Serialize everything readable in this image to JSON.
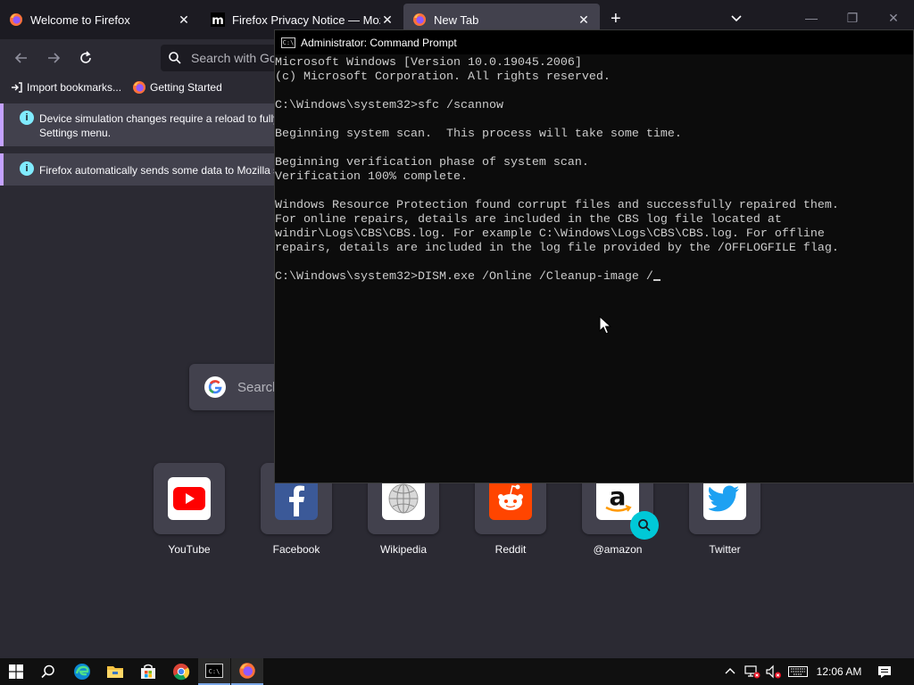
{
  "firefox": {
    "tabs": [
      {
        "label": "Welcome to Firefox",
        "active": false
      },
      {
        "label": "Firefox Privacy Notice — Mozilla",
        "active": false
      },
      {
        "label": "New Tab",
        "active": true
      }
    ],
    "urlbar_placeholder": "Search with Google or enter address",
    "bookmarks": [
      {
        "label": "Import bookmarks..."
      },
      {
        "label": "Getting Started"
      }
    ],
    "notices": [
      {
        "lines": [
          "Device simulation changes require a reload to fully apply. Automatic reloads are disabled by default to avoid losing any changes. You can enable the reload via the",
          "Settings menu."
        ]
      },
      {
        "lines": [
          "Firefox automatically sends some data to Mozilla so that we can improve your experience."
        ]
      }
    ],
    "web_search_placeholder": "Search the web",
    "top_sites": [
      {
        "name": "YouTube"
      },
      {
        "name": "Facebook"
      },
      {
        "name": "Wikipedia"
      },
      {
        "name": "Reddit"
      },
      {
        "name": "@amazon"
      },
      {
        "name": "Twitter"
      }
    ]
  },
  "cmd": {
    "title": "Administrator: Command Prompt",
    "lines": [
      "Microsoft Windows [Version 10.0.19045.2006]",
      "(c) Microsoft Corporation. All rights reserved.",
      "",
      "C:\\Windows\\system32>sfc /scannow",
      "",
      "Beginning system scan.  This process will take some time.",
      "",
      "Beginning verification phase of system scan.",
      "Verification 100% complete.",
      "",
      "Windows Resource Protection found corrupt files and successfully repaired them.",
      "For online repairs, details are included in the CBS log file located at",
      "windir\\Logs\\CBS\\CBS.log. For example C:\\Windows\\Logs\\CBS\\CBS.log. For offline",
      "repairs, details are included in the log file provided by the /OFFLOGFILE flag.",
      ""
    ],
    "input_line": "C:\\Windows\\system32>DISM.exe /Online /Cleanup-image /"
  },
  "taskbar": {
    "clock": "12:06 AM"
  },
  "colors": {
    "ff_bg": "#2b2a33",
    "ff_tabbar": "#1c1b22",
    "cmd_bg": "#0c0c0c",
    "cmd_text": "#cccccc",
    "notice_accent": "#c4a2ff",
    "info_icon": "#80ebff"
  }
}
